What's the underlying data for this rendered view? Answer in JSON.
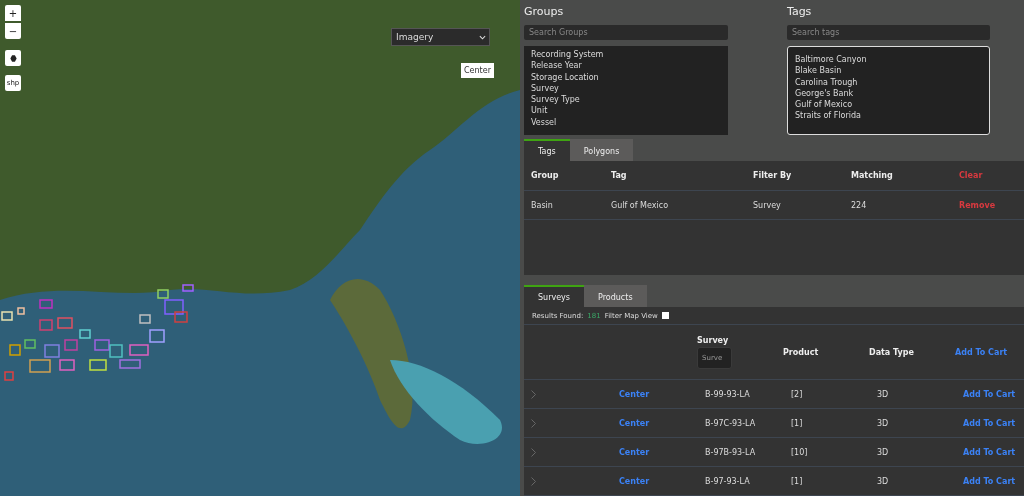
{
  "map": {
    "zoom_in": "+",
    "zoom_out": "−",
    "shape_button": "shp",
    "layer_select": {
      "value": "Imagery"
    },
    "center_button": "Center"
  },
  "groups": {
    "title": "Groups",
    "search": {
      "placeholder": "Search Groups"
    },
    "items": [
      "Recording System",
      "Release Year",
      "Storage Location",
      "Survey",
      "Survey Type",
      "Unit",
      "Vessel"
    ]
  },
  "tags": {
    "title": "Tags",
    "search": {
      "placeholder": "Search tags"
    },
    "items": [
      "Baltimore Canyon",
      "Blake Basin",
      "Carolina Trough",
      "George's Bank",
      "Gulf of Mexico",
      "Straits of Florida"
    ]
  },
  "filter_tabs": [
    {
      "label": "Tags",
      "selected": true
    },
    {
      "label": "Polygons",
      "selected": false
    }
  ],
  "filter_table": {
    "columns": [
      "Group",
      "Tag",
      "Filter By",
      "Matching"
    ],
    "clear": "Clear",
    "rows": [
      {
        "group": "Basin",
        "tag": "Gulf of Mexico",
        "filter_by": "Survey",
        "matching": "224",
        "action": "Remove"
      }
    ]
  },
  "result_tabs": [
    {
      "label": "Surveys",
      "selected": true
    },
    {
      "label": "Products",
      "selected": false
    }
  ],
  "results": {
    "label": "Results Found:",
    "count": "181",
    "filter_map_view": {
      "label": "Filter Map View",
      "checked": false
    }
  },
  "survey_table": {
    "columns": {
      "survey": "Survey",
      "survey_filter": {
        "placeholder": "Surve"
      },
      "product": "Product",
      "data_type": "Data Type",
      "add_all": "Add To Cart"
    },
    "rows": [
      {
        "center": "Center",
        "survey": "B-99-93-LA",
        "product": "[2]",
        "data_type": "3D",
        "action": "Add To Cart"
      },
      {
        "center": "Center",
        "survey": "B-97C-93-LA",
        "product": "[1]",
        "data_type": "3D",
        "action": "Add To Cart"
      },
      {
        "center": "Center",
        "survey": "B-97B-93-LA",
        "product": "[10]",
        "data_type": "3D",
        "action": "Add To Cart"
      },
      {
        "center": "Center",
        "survey": "B-97-93-LA",
        "product": "[1]",
        "data_type": "3D",
        "action": "Add To Cart"
      }
    ]
  }
}
